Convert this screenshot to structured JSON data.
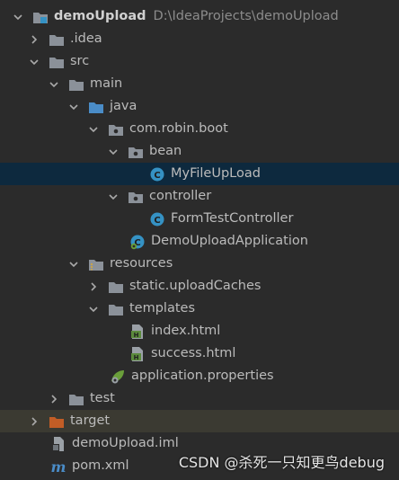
{
  "tree": {
    "project_name": "demoUpload",
    "project_path": "D:\\IdeaProjects\\demoUpload",
    "items": [
      {
        "label": "demoUpload"
      },
      {
        "label": ".idea"
      },
      {
        "label": "src"
      },
      {
        "label": "main"
      },
      {
        "label": "java"
      },
      {
        "label": "com.robin.boot"
      },
      {
        "label": "bean"
      },
      {
        "label": "MyFileUpLoad"
      },
      {
        "label": "controller"
      },
      {
        "label": "FormTestController"
      },
      {
        "label": "DemoUploadApplication"
      },
      {
        "label": "resources"
      },
      {
        "label": "static.uploadCaches"
      },
      {
        "label": "templates"
      },
      {
        "label": "index.html"
      },
      {
        "label": "success.html"
      },
      {
        "label": "application.properties"
      },
      {
        "label": "test"
      },
      {
        "label": "target"
      },
      {
        "label": "demoUpload.iml"
      },
      {
        "label": "pom.xml"
      }
    ]
  },
  "watermark": "CSDN @杀死一只知更鸟debug",
  "colors": {
    "background": "#2b2b2b",
    "selected_row": "#0d293e",
    "excluded_row": "#3b3a32",
    "folder": "#8b9199",
    "source_folder": "#4a8cc7",
    "class_icon": "#3592c4",
    "excluded_folder": "#c25d26"
  },
  "icons": {
    "module": "module-icon",
    "folder": "folder-icon",
    "source_folder": "source-folder-icon",
    "package": "package-icon",
    "class": "class-icon",
    "spring_class": "spring-boot-class-icon",
    "resources_folder": "resources-folder-icon",
    "html": "html-file-icon",
    "properties": "properties-file-icon",
    "excluded_folder": "excluded-folder-icon",
    "iml": "iml-file-icon",
    "maven": "maven-icon"
  }
}
